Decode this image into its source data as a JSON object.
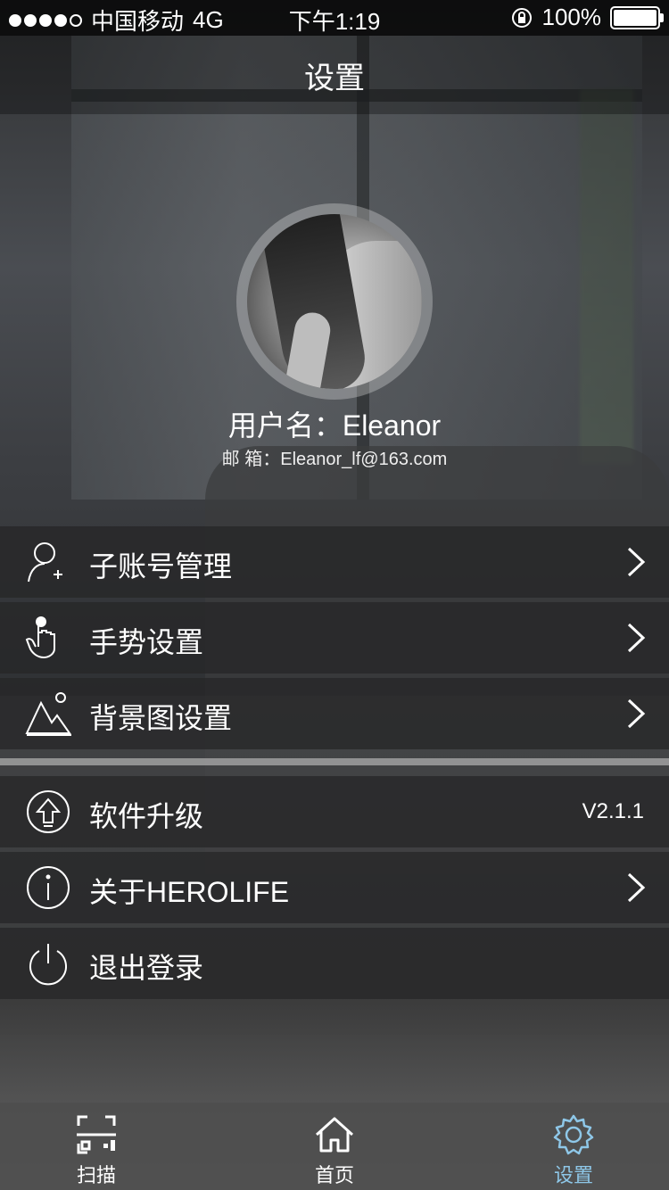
{
  "status_bar": {
    "carrier": "中国移动",
    "network": "4G",
    "time": "下午1:19",
    "battery": "100%"
  },
  "nav": {
    "title": "设置"
  },
  "profile": {
    "username": "用户名：Eleanor",
    "email": "邮 箱：Eleanor_lf@163.com"
  },
  "menu": {
    "group1": [
      {
        "label": "子账号管理",
        "icon": "user-add-icon"
      },
      {
        "label": "手势设置",
        "icon": "gesture-hand-icon"
      },
      {
        "label": "背景图设置",
        "icon": "landscape-image-icon"
      }
    ],
    "group2": [
      {
        "label": "软件升级",
        "icon": "upgrade-arrow-icon",
        "value": "V2.1.1"
      },
      {
        "label": "关于HEROLIFE",
        "icon": "info-icon"
      },
      {
        "label": "退出登录",
        "icon": "power-icon"
      }
    ]
  },
  "tabbar": {
    "tabs": [
      {
        "label": "扫描",
        "icon": "scan-icon"
      },
      {
        "label": "首页",
        "icon": "home-icon"
      },
      {
        "label": "设置",
        "icon": "settings-gear-icon",
        "active": true
      }
    ]
  },
  "colors": {
    "active_tab": "#8ec7e8"
  }
}
